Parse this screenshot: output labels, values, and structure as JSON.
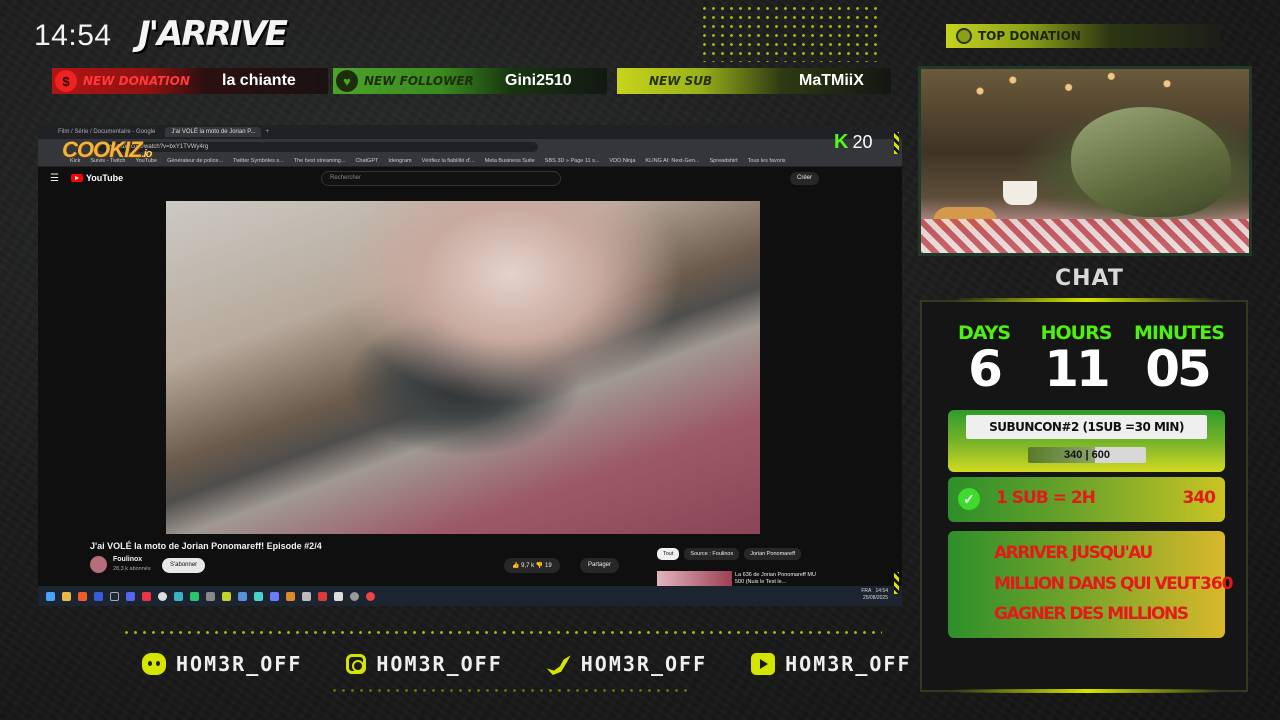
{
  "header": {
    "time": "14:54",
    "logo_text": "J'ARRIVE"
  },
  "alerts": {
    "donation": {
      "kind": "NEW DONATION",
      "who": "la chiante",
      "icon": "dollar-icon"
    },
    "follower": {
      "kind": "NEW FOLLOWER",
      "who": "Gini2510",
      "icon": "heart-icon"
    },
    "sub": {
      "kind": "NEW SUB",
      "who": "MaTMiiX"
    }
  },
  "capture": {
    "tabs": [
      "Film / Série / Documentaire - Google",
      "J'ai VOLÉ la moto de Jorian P..."
    ],
    "url": "youtube.com/watch?v=bxY1TVWy4rg",
    "bookmarks": [
      "Kick",
      "Suivis - Twitch",
      "YouTube",
      "Générateur de police...",
      "Twitter Symboles s...",
      "The best streaming...",
      "ChatGPT",
      "Ideogram",
      "Vérifiez la fiabilité d'...",
      "Meta Business Suite",
      "SBS 3D » Page 11 s...",
      "VDO.Ninja",
      "KLING AI: Next-Gen...",
      "Spreadshirt",
      "Tous les favoris"
    ],
    "youtube": {
      "logo": "YouTube",
      "search_placeholder": "Rechercher",
      "create": "Créer",
      "video_title": "J'ai VOLÉ la moto de Jorian Ponomareff! Episode #2/4",
      "channel": "Foulinox",
      "subscribers": "28,3 k abonnés",
      "subscribe": "S'abonner",
      "likes": "9,7 k",
      "dislikes": "19",
      "share": "Partager",
      "chips": [
        "Tout",
        "Source : Foulinox",
        "Jorian Ponomareff"
      ],
      "rec_title": "La 636 de Jorian Ponomareff MU 500 (Nuis le Test le..."
    },
    "taskbar": {
      "lang": "FRA",
      "time": "14:54",
      "date": "25/08/2025"
    },
    "overlay_brand": "COOKIZ",
    "overlay_brand_suffix": ".io",
    "kick_viewers": "20"
  },
  "right": {
    "top_donation_label": "TOP DONATION",
    "chat_label": "CHAT",
    "timer": {
      "days_label": "DAYS",
      "days": "6",
      "hours_label": "HOURS",
      "hours": "11",
      "minutes_label": "MINUTES",
      "minutes": "05"
    },
    "subuncon": {
      "title": "SUBUNCON#2 (1SUB =30 MIN)",
      "progress_text": "340 | 600",
      "current": 340,
      "goal": 600
    },
    "goal1": {
      "label": "1 SUB = 2H",
      "value": "340"
    },
    "goal2": {
      "lines": [
        "ARRIVER JUSQU'AU",
        "MILLION DANS QUI VEUT",
        "GAGNER DES MILLIONS"
      ],
      "value": "360"
    }
  },
  "socials": [
    {
      "network": "discord-icon",
      "handle": "HOM3R_OFF"
    },
    {
      "network": "instagram-icon",
      "handle": "HOM3R_OFF"
    },
    {
      "network": "twitter-icon",
      "handle": "HOM3R_OFF"
    },
    {
      "network": "youtube-icon",
      "handle": "HOM3R_OFF"
    }
  ],
  "colors": {
    "accent": "#d4e600",
    "donation": "#b31414",
    "follower": "#4ca32a",
    "timer_label": "#4ff00f",
    "goal_text": "#e41a1a"
  }
}
